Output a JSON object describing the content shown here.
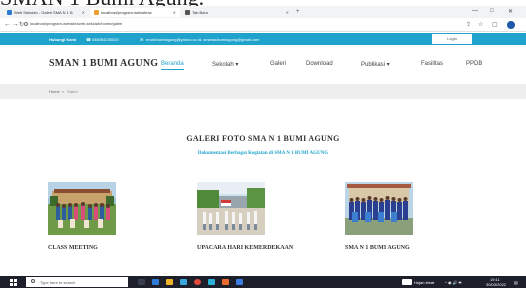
{
  "caption_fragment": "SMAN 1 Bumi Agung.",
  "browser": {
    "tabs": [
      {
        "label": "Web Sekolah - Galeri SMA N 1 B"
      },
      {
        "label": "localhost/program-website/w"
      },
      {
        "label": "Tab Baru"
      }
    ],
    "new_tab": "+",
    "url": "localhost/program-website/web-sekolah/home/galeri",
    "window_controls": [
      "—",
      "□",
      "✕"
    ]
  },
  "topbar": {
    "contact_name": "Hubungi Kami",
    "phone": "085084230020",
    "email": "email:bumiagung@yahoo.co.id, smanaubumiagung@gmail.com",
    "login_label": "Login"
  },
  "nav": {
    "brand": "SMAN 1 BUMI AGUNG",
    "items": [
      {
        "label": "Beranda",
        "active": true
      },
      {
        "label": "Sekolah ▾",
        "active": false
      },
      {
        "label": "Galeri",
        "active": false
      },
      {
        "label": "Download",
        "active": false
      },
      {
        "label": "Publikasi ▾",
        "active": false
      },
      {
        "label": "Fasilitas",
        "active": false
      },
      {
        "label": "PPDB",
        "active": false
      }
    ]
  },
  "breadcrumb": {
    "home": "Home",
    "separator": "»",
    "current": "Galeri"
  },
  "gallery": {
    "title": "GALERI FOTO SMA N 1 BUMI AGUNG",
    "subtitle": "Dokumentasi Berbagai Kegiatan di SMA N 1 BUMI AGUNG",
    "photos": [
      {
        "caption": "CLASS MEETING"
      },
      {
        "caption": "UPACARA HARI KEMERDEKAAN"
      },
      {
        "caption": "SMA N 1 BUMI AGUNG"
      }
    ]
  },
  "taskbar": {
    "search_placeholder": "Type here to search",
    "weather": "Hujan lebat",
    "time": "19:11",
    "date": "30/03/2022"
  },
  "colors": {
    "accent": "#1fa3cc",
    "taskbar": "#1d1f2b"
  }
}
